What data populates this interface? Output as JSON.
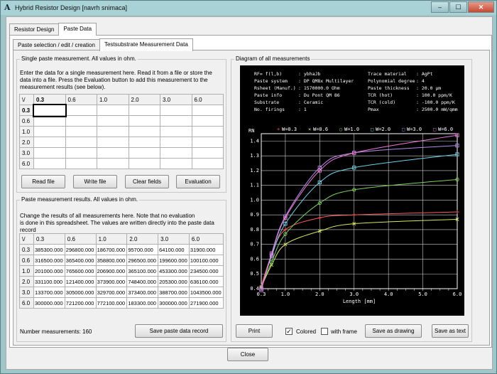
{
  "window": {
    "title": "Hybrid Resistor Design  [navrh snimaca]",
    "min_glyph": "–",
    "max_glyph": "☐",
    "close_glyph": "✕"
  },
  "tabs_main": [
    "Resistor Design",
    "Paste Data"
  ],
  "tabs_sub": [
    "Paste selection / edit / creation",
    "Testsubstrate Measurement Data"
  ],
  "single": {
    "title": "Single paste measurement. All values in ohm.",
    "help": [
      "Enter the data for a single measurement here. Read it from a file or store the",
      "data into a file. Press the Evaluation button to add this measurement to the",
      "measurement results (see below)."
    ],
    "corner": "\\/",
    "columns": [
      "0.3",
      "0.6",
      "1.0",
      "2.0",
      "3.0",
      "6.0"
    ],
    "rows": [
      "0.3",
      "0.6",
      "1.0",
      "2.0",
      "3.0",
      "6.0"
    ],
    "buttons": [
      "Read file",
      "Write file",
      "Clear fields",
      "Evaluation"
    ]
  },
  "results": {
    "title": "Paste measurement results. All values in ohm.",
    "help": [
      "Change the results of all measurements here. Note that no evaluation",
      "is done in this spreadsheet. The values are written directly into the paste data record"
    ],
    "corner": "\\/",
    "columns": [
      "0.3",
      "0.6",
      "1.0",
      "2.0",
      "3.0",
      "6.0"
    ],
    "rows": [
      {
        "h": "0.3",
        "v": [
          "385300.000",
          "296800.000",
          "186700.000",
          "95700.000",
          "64100.000",
          "31900.000"
        ]
      },
      {
        "h": "0.6",
        "v": [
          "316500.000",
          "365400.000",
          "358800.000",
          "296500.000",
          "199600.000",
          "100100.000"
        ]
      },
      {
        "h": "1.0",
        "v": [
          "201000.000",
          "765600.000",
          "206900.000",
          "365100.000",
          "453300.000",
          "234500.000"
        ]
      },
      {
        "h": "2.0",
        "v": [
          "331100.000",
          "121400.000",
          "373900.000",
          "748400.000",
          "205300.000",
          "636100.000"
        ]
      },
      {
        "h": "3.0",
        "v": [
          "133700.000",
          "305000.000",
          "329700.000",
          "373400.000",
          "388700.000",
          "1043500.000"
        ]
      },
      {
        "h": "6.0",
        "v": [
          "300000.000",
          "721200.000",
          "772100.000",
          "183300.000",
          "300000.000",
          "271900.000"
        ]
      }
    ],
    "count_label": "Number measurements: 160",
    "save_button": "Save paste data record"
  },
  "diagram": {
    "title": "Diagram of all measurements",
    "info_left": [
      [
        "RF= f(l,b)",
        ": ybhaJb"
      ],
      [
        "Paste system",
        ": DP QM8x Multilayer"
      ],
      [
        "Rsheet (Manuf.)",
        ": 1570000.0 Ohm"
      ],
      [
        "Paste info",
        ": Du Pont QM 86"
      ],
      [
        "Substrate",
        ": Ceramic"
      ],
      [
        "No. firings",
        ": 1"
      ]
    ],
    "info_right": [
      [
        "Trace material",
        ": AgPt"
      ],
      [
        "Polynomial degree",
        ": 4"
      ],
      [
        "Paste thickness",
        ": 20.0 μm"
      ],
      [
        "TCR (hot)",
        ": 100.0 ppm/K"
      ],
      [
        "TCR (cold)",
        ": -100.0 ppm/K"
      ],
      [
        "Pmax",
        ": 2500.0 mW/qmm"
      ]
    ],
    "buttons": {
      "print": "Print",
      "colored": "Colored",
      "with_frame": "with frame",
      "save_drawing": "Save as drawing",
      "save_text": "Save as text"
    },
    "colored_checked": true,
    "frame_checked": false
  },
  "chart_data": {
    "type": "line",
    "ylabel": "RN",
    "xlabel": "Length [mm]",
    "xlim": [
      0.3,
      6.0
    ],
    "ylim": [
      0.4,
      1.45
    ],
    "x_ticks": [
      "0.3",
      "1.0",
      "2.0",
      "3.0",
      "4.0",
      "5.0",
      "6.0"
    ],
    "y_ticks": [
      "0.4",
      "0.5",
      "0.6",
      "0.7",
      "0.8",
      "0.9",
      "1.0",
      "1.1",
      "1.2",
      "1.3",
      "1.4"
    ],
    "grid": true,
    "legend": "top",
    "series": [
      {
        "name": "W=0.3",
        "marker": "+",
        "color": "#ff5a5a",
        "x": [
          0.3,
          0.6,
          1.0,
          2.0,
          3.0,
          6.0
        ],
        "y": [
          0.42,
          0.63,
          0.8,
          0.88,
          0.9,
          0.92
        ]
      },
      {
        "name": "W=0.6",
        "marker": "x",
        "color": "#d7e85a",
        "x": [
          0.3,
          0.6,
          1.0,
          2.0,
          3.0,
          6.0
        ],
        "y": [
          0.41,
          0.56,
          0.7,
          0.79,
          0.84,
          0.87
        ]
      },
      {
        "name": "W=1.0",
        "marker": "o",
        "color": "#7ad35a",
        "x": [
          0.3,
          0.6,
          1.0,
          2.0,
          3.0,
          6.0
        ],
        "y": [
          0.41,
          0.58,
          0.77,
          0.98,
          1.07,
          1.14
        ]
      },
      {
        "name": "W=2.0",
        "marker": "s",
        "color": "#6fd3e6",
        "x": [
          0.3,
          0.6,
          1.0,
          2.0,
          3.0,
          6.0
        ],
        "y": [
          0.4,
          0.62,
          0.84,
          1.12,
          1.22,
          1.31
        ]
      },
      {
        "name": "W=3.0",
        "marker": "s",
        "color": "#b48ce6",
        "x": [
          0.3,
          0.6,
          1.0,
          2.0,
          3.0,
          6.0
        ],
        "y": [
          0.4,
          0.64,
          0.89,
          1.22,
          1.32,
          1.37
        ]
      },
      {
        "name": "W=6.0",
        "marker": "s",
        "color": "#ee7bdc",
        "x": [
          0.3,
          0.6,
          1.0,
          2.0,
          3.0,
          6.0
        ],
        "y": [
          0.39,
          0.63,
          0.88,
          1.2,
          1.32,
          1.44
        ]
      }
    ]
  },
  "footer": {
    "close_button": "Close"
  }
}
